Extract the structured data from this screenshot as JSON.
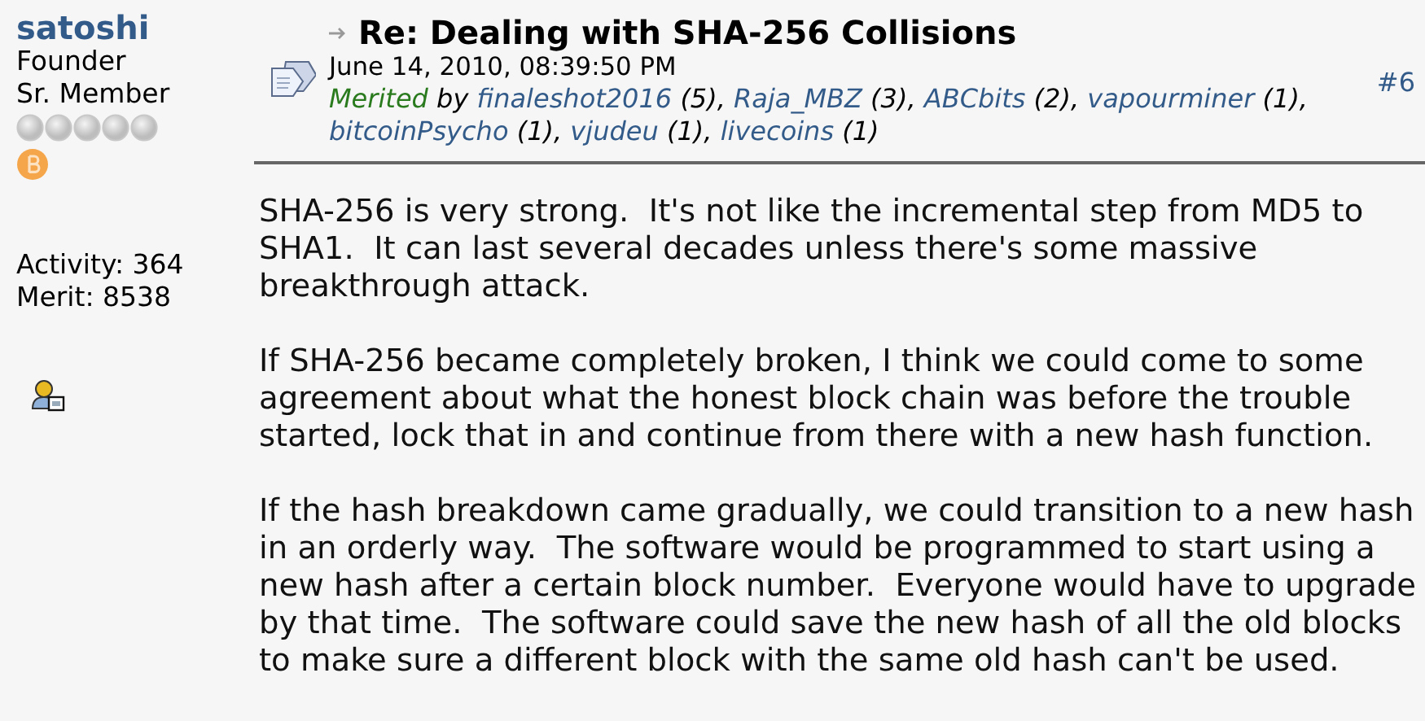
{
  "author": {
    "name": "satoshi",
    "title": "Founder",
    "rank": "Sr. Member",
    "activity": "Activity: 364",
    "merit": "Merit: 8538"
  },
  "post": {
    "title": "Re: Dealing with SHA-256 Collisions",
    "date": "June 14, 2010, 08:39:50 PM",
    "merited_label": "Merited",
    "by": "by",
    "number": "#6",
    "merits": [
      {
        "user": "finaleshot2016",
        "count": "(5),"
      },
      {
        "user": "Raja_MBZ",
        "count": "(3),"
      },
      {
        "user": "ABCbits",
        "count": "(2),"
      },
      {
        "user": "vapourminer",
        "count": "(1),"
      },
      {
        "user": "bitcoinPsycho",
        "count": "(1),"
      },
      {
        "user": "vjudeu",
        "count": "(1),"
      },
      {
        "user": "livecoins",
        "count": "(1)"
      }
    ],
    "paragraphs": [
      [
        "SHA-256 is very strong.  It's not like the incremental step from MD5 to",
        "SHA1.  It can last several decades unless there's some massive",
        "breakthrough attack."
      ],
      [
        "If SHA-256 became completely broken, I think we could come to some",
        "agreement about what the honest block chain was before the trouble",
        "started, lock that in and continue from there with a new hash function."
      ],
      [
        "If the hash breakdown came gradually, we could transition to a new hash",
        "in an orderly way.  The software would be programmed to start using a",
        "new hash after a certain block number.  Everyone would have to upgrade",
        "by that time.  The software could save the new hash of all the old blocks",
        "to make sure a different block with the same old hash can't be used."
      ]
    ]
  }
}
